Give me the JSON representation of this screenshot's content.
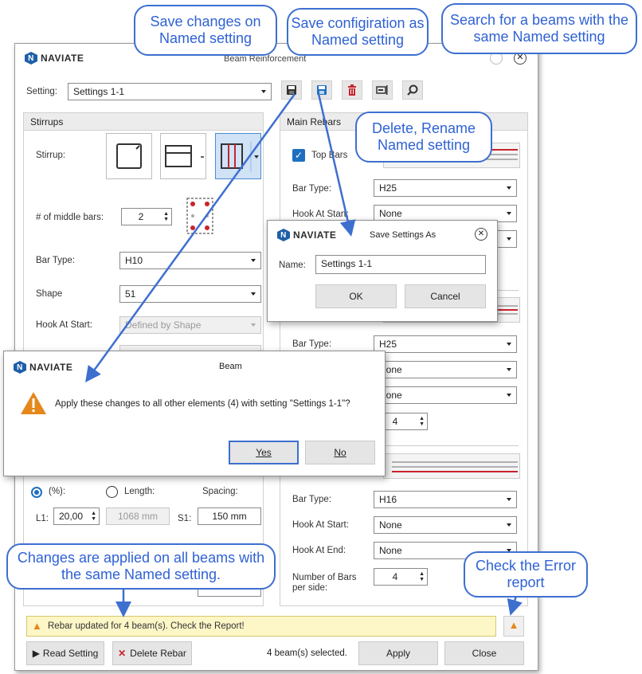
{
  "main_window": {
    "app_logo": "NAVIATE",
    "title": "Beam Reinforcement",
    "setting_label": "Setting:",
    "setting_value": "Settings 1-1",
    "stirrups": {
      "header": "Stirrups",
      "stirrup_label": "Stirrup:",
      "middle_bars_label": "# of middle bars:",
      "middle_bars_value": "2",
      "bar_type_label": "Bar Type:",
      "bar_type_value": "H10",
      "shape_label": "Shape",
      "shape_value": "51",
      "hook_at_start_label": "Hook At Start:",
      "hook_at_start_value": "Defined by Shape",
      "percent_label": "(%):",
      "length_label": "Length:",
      "spacing_label": "Spacing:",
      "l1_label": "L1:",
      "l1_value": "20,00",
      "length_value": "1068 mm",
      "s1_label": "S1:",
      "s1_value": "150 mm"
    },
    "main_rebars": {
      "header": "Main Rebars",
      "top_bars_label": "Top Bars",
      "top_bar_type_label": "Bar Type:",
      "top_bar_type_value": "H25",
      "top_hook_start_label": "Hook At Start:",
      "top_hook_start_value": "None",
      "mid_bar_type_label": "Bar Type:",
      "mid_bar_type_value": "H25",
      "mid_hook_start_value": "None",
      "mid_hook_end_value": "None",
      "mid_number_value": "4",
      "bottom_bar_type_label": "Bar Type:",
      "bottom_bar_type_value": "H16",
      "bottom_hook_start_label": "Hook At Start:",
      "bottom_hook_start_value": "None",
      "bottom_hook_end_label": "Hook At End:",
      "bottom_hook_end_value": "None",
      "bottom_number_label_1": "Number of Bars",
      "bottom_number_label_2": "per side:",
      "bottom_number_value": "4"
    },
    "status_message": "Rebar updated for 4 beam(s). Check the Report!",
    "read_setting": "Read Setting",
    "delete_rebar": "Delete Rebar",
    "selection_status": "4 beam(s) selected.",
    "apply": "Apply",
    "close": "Close"
  },
  "save_dialog": {
    "logo": "NAVIATE",
    "title": "Save Settings As",
    "name_label": "Name:",
    "name_value": "Settings 1-1",
    "ok": "OK",
    "cancel": "Cancel"
  },
  "beam_dialog": {
    "logo": "NAVIATE",
    "title": "Beam",
    "message": "Apply these changes to all other elements (4) with setting \"Settings 1-1\"?",
    "yes": "Yes",
    "no": "No"
  },
  "callouts": {
    "save_changes": "Save changes on Named setting",
    "save_config": "Save configiration as Named setting",
    "search": "Search for a beams with the same Named setting",
    "delete_rename": "Delete, Rename Named setting",
    "changes_applied": "Changes are applied on all beams with the same Named setting.",
    "error_report": "Check the Error report"
  },
  "colors": {
    "callout_blue": "#2f62d4",
    "callout_border": "#3d6fcf",
    "warning_orange": "#e5871b",
    "delete_red": "#c8242e",
    "accent_blue": "#1f5fa8",
    "status_yellow": "#fdf6c7"
  }
}
